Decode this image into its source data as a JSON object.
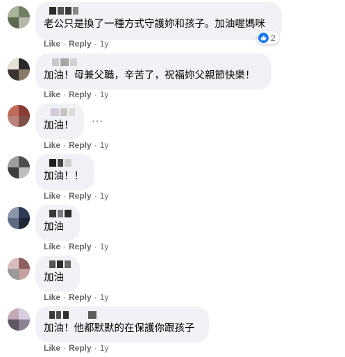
{
  "actions": {
    "like_label": "Like",
    "reply_label": "Reply",
    "separator": "·"
  },
  "colors": {
    "bubble": "#f0f2f5",
    "action_text": "#65676b",
    "like_blue": "#1877f2"
  },
  "comments": [
    {
      "text": "老公只是換了一種方式守護妳和孩子。加油喔媽咪",
      "timestamp": "1y",
      "reaction_count": "2",
      "reaction_icon": "like-icon"
    },
    {
      "text": "加油！母兼父職，辛苦了，祝福妳父親節快樂！",
      "timestamp": "1y"
    },
    {
      "text": "加油！",
      "timestamp": "1y",
      "more_icon": "ellipsis-icon",
      "more_label": "···"
    },
    {
      "text": "加油！！",
      "timestamp": "1y"
    },
    {
      "text": "加油",
      "timestamp": "1y"
    },
    {
      "text": "加油",
      "timestamp": "1y"
    },
    {
      "text": "加油！他都默默的在保護你跟孩子",
      "timestamp": "1y"
    }
  ]
}
